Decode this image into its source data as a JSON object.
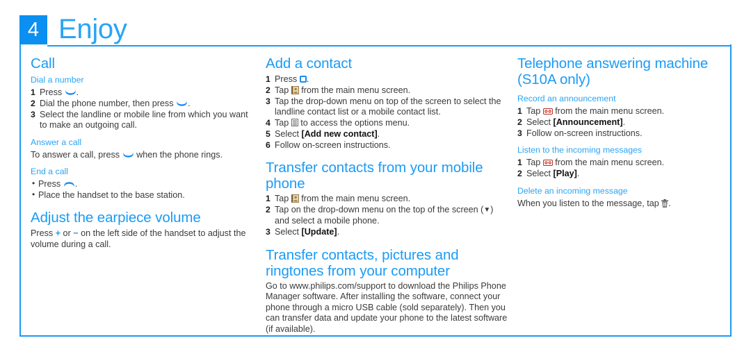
{
  "header": {
    "step_number": "4",
    "title": "Enjoy",
    "accent_color": "#1a9bf5",
    "badge_color": "#0b8ff0"
  },
  "columns": {
    "col1": {
      "call": {
        "heading": "Call",
        "dial": {
          "subheading": "Dial a number",
          "steps": [
            {
              "num": "1",
              "text_before": "Press ",
              "icon": "handset-answer-icon",
              "text_after": "."
            },
            {
              "num": "2",
              "text_before": "Dial the phone number, then press ",
              "icon": "handset-answer-icon",
              "text_after": "."
            },
            {
              "num": "3",
              "text_before": "Select the landline or mobile line from which you want to make an outgoing call.",
              "icon": "",
              "text_after": ""
            }
          ]
        },
        "answer": {
          "subheading": "Answer a call",
          "text_before": "To answer a call, press ",
          "icon": "handset-answer-icon",
          "text_after": " when the phone rings."
        },
        "end": {
          "subheading": "End a call",
          "bullets": [
            {
              "text_before": "Press ",
              "icon": "handset-end-icon",
              "text_after": "."
            },
            {
              "text_before": "Place the handset to the base station.",
              "icon": "",
              "text_after": ""
            }
          ]
        }
      },
      "volume": {
        "heading": "Adjust the earpiece volume",
        "text_1": "Press ",
        "plus": "+",
        "text_2": " or ",
        "minus": "−",
        "text_3": " on the left side of the handset to adjust the volume during a call."
      }
    },
    "col2": {
      "add_contact": {
        "heading": "Add a contact",
        "steps": [
          {
            "num": "1",
            "text_before": "Press ",
            "icon": "home-key-icon",
            "text_after": "."
          },
          {
            "num": "2",
            "text_before": "Tap ",
            "icon": "contacts-icon",
            "text_after": " from the main menu screen."
          },
          {
            "num": "3",
            "text_before": "Tap the drop-down menu on top of the screen to select the landline contact list or a mobile contact list.",
            "icon": "",
            "text_after": ""
          },
          {
            "num": "4",
            "text_before": "Tap ",
            "icon": "options-menu-icon",
            "text_after": " to access the options menu."
          },
          {
            "num": "5",
            "text_before": "Select ",
            "icon": "",
            "bold": "[Add new contact]",
            "text_after": "."
          },
          {
            "num": "6",
            "text_before": "Follow on-screen instructions.",
            "icon": "",
            "text_after": ""
          }
        ]
      },
      "transfer_mobile": {
        "heading": "Transfer contacts from your mobile phone",
        "steps": [
          {
            "num": "1",
            "text_before": "Tap ",
            "icon": "contacts-icon",
            "text_after": " from the main menu screen."
          },
          {
            "num": "2",
            "text_before": "Tap on the drop-down menu on the top of the screen (",
            "icon": "caret-down-icon",
            "text_after": ") and select a mobile phone."
          },
          {
            "num": "3",
            "text_before": "Select ",
            "icon": "",
            "bold": "[Update]",
            "text_after": "."
          }
        ]
      },
      "transfer_computer": {
        "heading": "Transfer contacts, pictures and ringtones from your computer",
        "body": "Go to www.philips.com/support to download the Philips Phone Manager software. After installing the software, connect your phone through a micro USB cable (sold separately). Then you can transfer data and update your phone to the latest software (if available)."
      }
    },
    "col3": {
      "answering_machine": {
        "heading_line1": "Telephone answering machine",
        "heading_line2": "(S10A only)",
        "record": {
          "subheading": "Record an announcement",
          "steps": [
            {
              "num": "1",
              "text_before": "Tap ",
              "icon": "answering-machine-icon",
              "text_after": " from the main menu screen."
            },
            {
              "num": "2",
              "text_before": "Select ",
              "icon": "",
              "bold": "[Announcement]",
              "text_after": "."
            },
            {
              "num": "3",
              "text_before": "Follow on-screen instructions.",
              "icon": "",
              "text_after": ""
            }
          ]
        },
        "listen": {
          "subheading": "Listen to the incoming messages",
          "steps": [
            {
              "num": "1",
              "text_before": "Tap ",
              "icon": "answering-machine-icon",
              "text_after": " from the main menu screen."
            },
            {
              "num": "2",
              "text_before": "Select ",
              "icon": "",
              "bold": "[Play]",
              "text_after": "."
            }
          ]
        },
        "delete": {
          "subheading": "Delete an incoming message",
          "text_before": "When you listen to the message, tap ",
          "icon": "trash-icon",
          "text_after": "."
        }
      }
    }
  }
}
